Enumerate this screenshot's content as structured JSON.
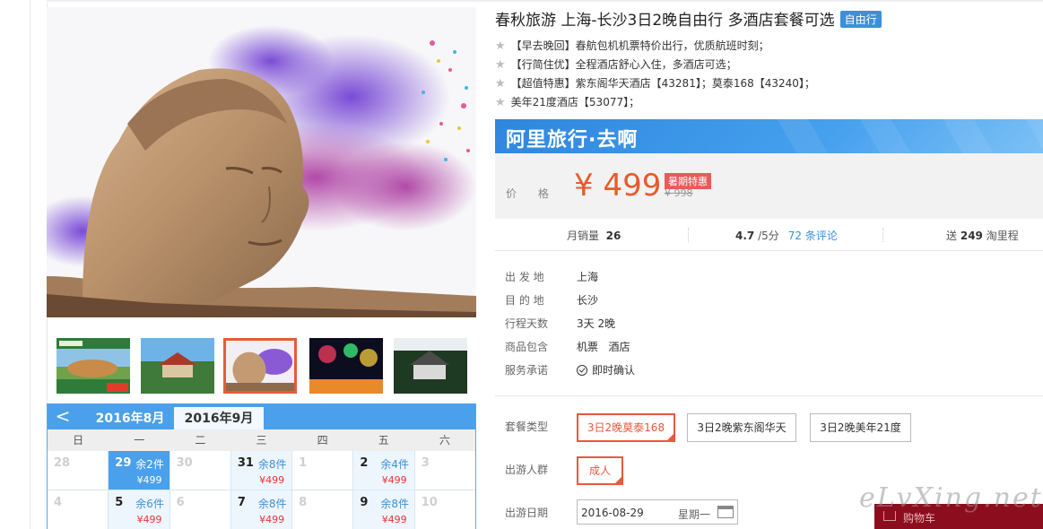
{
  "product": {
    "title": "春秋旅游 上海-长沙3日2晚自由行 多酒店套餐可选",
    "badge": "自由行",
    "features": [
      "【早去晚回】春航包机机票特价出行，优质航班时刻；",
      "【行简住优】全程酒店舒心入住，多酒店可选；",
      "【超值特惠】紫东阁华天酒店【43281】；莫泰168【43240】；",
      "美年21度酒店【53077】；"
    ]
  },
  "banner": {
    "text": "阿里旅行·去啊"
  },
  "price": {
    "label": "价 格",
    "current": "¥ 499",
    "promo": "暑期特惠",
    "original": "¥ 998"
  },
  "stats": {
    "sales_label": "月销量",
    "sales_value": "26",
    "rating": "4.7",
    "rating_suffix": "/5分",
    "reviews": "72 条评论",
    "points_prefix": "送",
    "points_value": "249",
    "points_suffix": "淘里程"
  },
  "details": [
    {
      "key": "出 发 地",
      "value": "上海"
    },
    {
      "key": "目 的 地",
      "value": "长沙"
    },
    {
      "key": "行程天数",
      "value": "3天 2晚"
    },
    {
      "key": "商品包含",
      "value": "机票   酒店"
    },
    {
      "key": "服务承诺",
      "value": "即时确认"
    }
  ],
  "options": {
    "package_label": "套餐类型",
    "packages": [
      "3日2晚莫泰168",
      "3日2晚紫东阁华天",
      "3日2晚美年21度"
    ],
    "traveler_label": "出游人群",
    "traveler": "成人",
    "date_label": "出游日期",
    "date_value": "2016-08-29",
    "weekday": "星期一"
  },
  "calendar": {
    "prev": "<",
    "month_tabs": [
      "2016年8月",
      "2016年9月"
    ],
    "weekdays": [
      "日",
      "一",
      "二",
      "三",
      "四",
      "五",
      "六"
    ],
    "rows": [
      [
        {
          "day": "28"
        },
        {
          "day": "29",
          "stock": "余2件",
          "price": "¥499",
          "selected": true
        },
        {
          "day": "30"
        },
        {
          "day": "31",
          "stock": "余8件",
          "price": "¥499"
        },
        {
          "day": "1"
        },
        {
          "day": "2",
          "stock": "余4件",
          "price": "¥499"
        },
        {
          "day": "3"
        }
      ],
      [
        {
          "day": "4"
        },
        {
          "day": "5",
          "stock": "余6件",
          "price": "¥499"
        },
        {
          "day": "6"
        },
        {
          "day": "7",
          "stock": "余8件",
          "price": "¥499"
        },
        {
          "day": "8"
        },
        {
          "day": "9",
          "stock": "余8件",
          "price": "¥499"
        },
        {
          "day": "10"
        }
      ]
    ]
  },
  "cart": {
    "label": "购物车"
  },
  "watermark": "eLvXing.net",
  "colors": {
    "accent": "#e75a3a",
    "blue": "#4aa0ea",
    "price": "#e85a2a"
  }
}
